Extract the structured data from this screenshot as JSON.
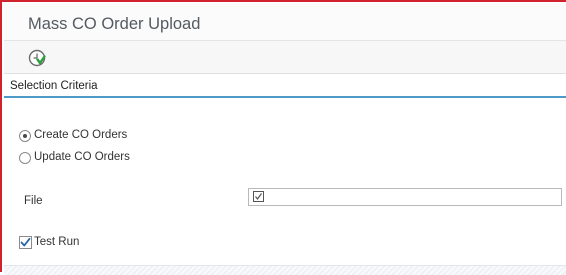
{
  "window": {
    "title": "Mass CO Order Upload"
  },
  "toolbar": {
    "execute_icon": "execute-clock-icon"
  },
  "selection": {
    "title": "Selection Criteria",
    "options": [
      {
        "label": "Create CO Orders",
        "selected": true
      },
      {
        "label": "Update CO Orders",
        "selected": false
      }
    ],
    "file": {
      "label": "File",
      "value": "",
      "icon": "checkbox-help-icon"
    },
    "test_run": {
      "label": "Test Run",
      "checked": true
    }
  },
  "colors": {
    "frame_border": "#d0232e",
    "accent_line": "#4d9ac9",
    "execute_icon_green": "#2e9e3e"
  }
}
